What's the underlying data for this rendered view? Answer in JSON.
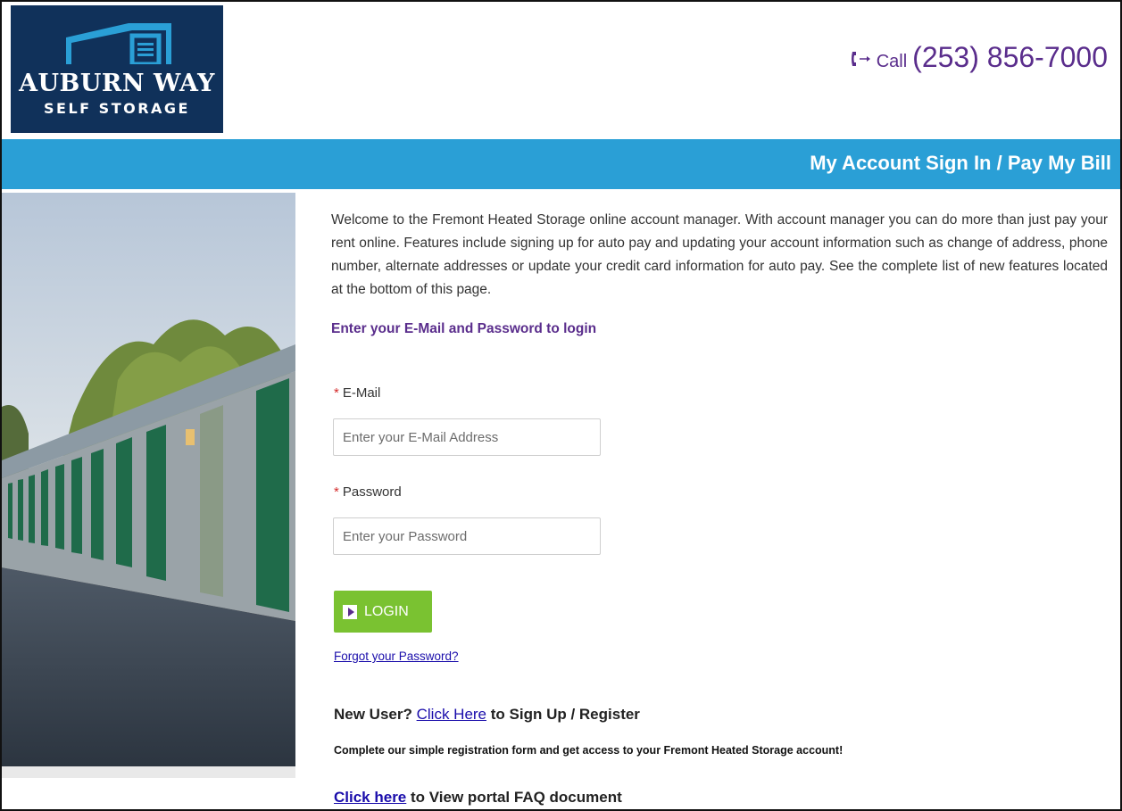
{
  "logo": {
    "name": "AUBURN WAY",
    "sub": "SELF STORAGE"
  },
  "phone": {
    "icon": "phone-icon",
    "call_label": "Call",
    "number": "(253) 856-7000"
  },
  "band": {
    "title": "My Account Sign In / Pay My Bill"
  },
  "intro": "Welcome to the Fremont Heated Storage online account manager. With account manager you can do more than just pay your rent online. Features include signing up for auto pay and updating your account information such as change of address, phone number, alternate addresses or update your credit card information for auto pay. See the complete list of new features located at the bottom of this page.",
  "login": {
    "heading": "Enter your E-Mail and Password to login",
    "email_label": "E-Mail",
    "email_placeholder": "Enter your E-Mail Address",
    "password_label": "Password",
    "password_placeholder": "Enter your Password",
    "required_mark": "*",
    "button_label": "LOGIN",
    "forgot_link": "Forgot your Password?"
  },
  "register": {
    "prefix": "New User?",
    "link": "Click Here",
    "suffix": "to Sign Up / Register",
    "note": "Complete our simple registration form and get access to your Fremont Heated Storage account!"
  },
  "faq": {
    "link": "Click here",
    "suffix": "to View portal FAQ document"
  },
  "colors": {
    "brand_navy": "#10315a",
    "band_blue": "#2a9fd6",
    "accent_purple": "#5a2d8c",
    "login_green": "#7ac231"
  }
}
